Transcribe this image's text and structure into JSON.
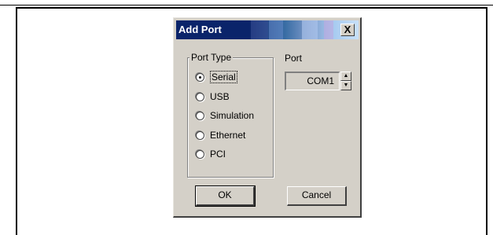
{
  "dialog": {
    "title": "Add Port",
    "close_label": "X",
    "group_title": "Port Type",
    "port_types": [
      {
        "label": "Serial",
        "checked": true
      },
      {
        "label": "USB",
        "checked": false
      },
      {
        "label": "Simulation",
        "checked": false
      },
      {
        "label": "Ethernet",
        "checked": false
      },
      {
        "label": "PCI",
        "checked": false
      }
    ],
    "port_label": "Port",
    "port_value": "COM1",
    "ok_label": "OK",
    "cancel_label": "Cancel"
  },
  "icons": {
    "close": "close-icon",
    "spin_up": "chevron-up-icon",
    "spin_down": "chevron-down-icon"
  },
  "colors": {
    "dialog_face": "#d4d0c8",
    "titlebar_start": "#0a246a",
    "titlebar_end": "#c8e0f8"
  }
}
